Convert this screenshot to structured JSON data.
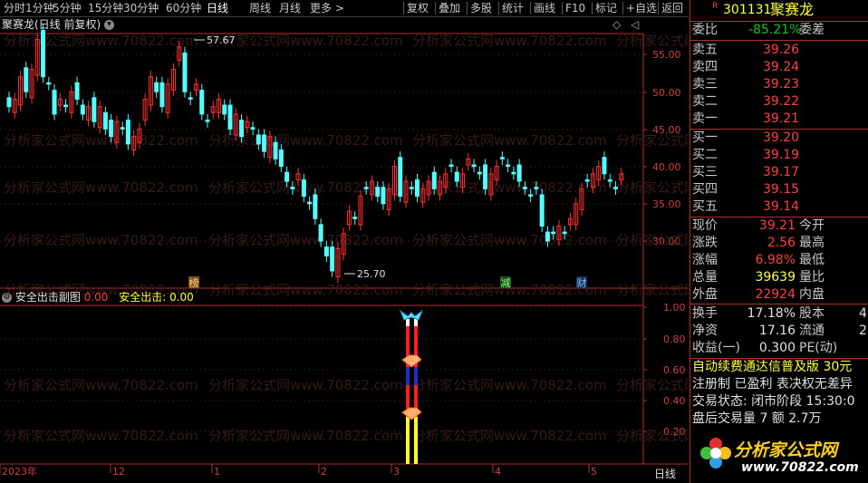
{
  "toolbar": {
    "left_items": [
      "分时",
      "1分钟",
      "5分钟",
      "15分钟",
      "30分钟",
      "60分钟",
      "日线",
      "周线",
      "月线",
      "更多 >"
    ],
    "right_items": [
      "复权",
      "叠加",
      "多股",
      "统计",
      "画线",
      "F10",
      "标记",
      "+自选",
      "返回"
    ]
  },
  "chart": {
    "title": "聚赛龙(日线 前复权)",
    "title_icon": "chevron-down-icon",
    "high_label": "57.67",
    "low_label": "25.70",
    "y_axis": [
      "55.00",
      "50.00",
      "45.00",
      "40.00",
      "35.00",
      "30.00"
    ],
    "markers": [
      "榜",
      "减",
      "财"
    ],
    "candle_up_color": "#ff3030",
    "candle_down_color": "#54ffff"
  },
  "indicator": {
    "name": "安全出击副图",
    "value": "0.00",
    "series_label": "安全出击:",
    "series_value": "0.00",
    "y_axis": [
      "1.00",
      "0.80",
      "0.60",
      "0.40",
      "0.20"
    ]
  },
  "dates": [
    "2023年",
    "12",
    "1",
    "2",
    "3",
    "4",
    "5"
  ],
  "watermark": "分析家公式网www.70822.com",
  "panel": {
    "badge": "R",
    "code": "301131",
    "name": "聚赛龙",
    "weibi_label": "委比",
    "weibi_value": "-85.21%",
    "weicha_label": "委差",
    "asks": [
      {
        "label": "卖五",
        "price": "39.26"
      },
      {
        "label": "卖四",
        "price": "39.24"
      },
      {
        "label": "卖三",
        "price": "39.23"
      },
      {
        "label": "卖二",
        "price": "39.22"
      },
      {
        "label": "卖一",
        "price": "39.21"
      }
    ],
    "bids": [
      {
        "label": "买一",
        "price": "39.20"
      },
      {
        "label": "买二",
        "price": "39.19"
      },
      {
        "label": "买三",
        "price": "39.17"
      },
      {
        "label": "买四",
        "price": "39.15"
      },
      {
        "label": "买五",
        "price": "39.14"
      }
    ],
    "stats": [
      {
        "label": "现价",
        "value": "39.21",
        "label2": "今开"
      },
      {
        "label": "涨跌",
        "value": "2.56",
        "label2": "最高"
      },
      {
        "label": "涨幅",
        "value": "6.98%",
        "label2": "最低"
      },
      {
        "label": "总量",
        "value": "39639",
        "label2": "量比"
      },
      {
        "label": "外盘",
        "value": "22924",
        "label2": "内盘"
      }
    ],
    "stats2": [
      {
        "label": "换手",
        "value": "17.18%",
        "label2": "股本",
        "extra": "4"
      },
      {
        "label": "净资",
        "value": "17.16",
        "label2": "流通",
        "extra": "2"
      },
      {
        "label": "收益(一)",
        "value": "0.300",
        "label2": "PE(动)",
        "extra": ""
      }
    ],
    "info": [
      "自动续费通达信普及版  30元",
      "注册制 已盈利 表决权无差异",
      "交易状态: 闭市阶段 15:30:0",
      "盘后交易量 7 额 2.7万"
    ],
    "logo_text": "分析家公式网",
    "logo_url_text": "www.70822.com",
    "period_label": "日线"
  }
}
